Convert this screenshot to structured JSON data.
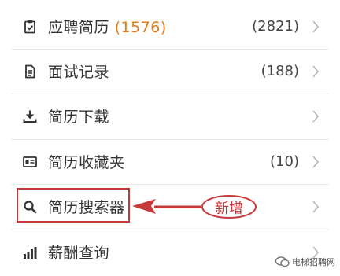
{
  "menu": {
    "items": [
      {
        "label": "应聘简历",
        "label_highlight": "(1576)",
        "count": "(2821)",
        "icon": "resume-clipboard-icon"
      },
      {
        "label": "面试记录",
        "count": "(188)",
        "icon": "document-icon"
      },
      {
        "label": "简历下载",
        "count": "",
        "icon": "download-icon"
      },
      {
        "label": "简历收藏夹",
        "count": "(10)",
        "icon": "id-card-icon"
      },
      {
        "label": "简历搜索器",
        "count": "",
        "icon": "search-icon"
      },
      {
        "label": "薪酬查询",
        "count": "",
        "icon": "bar-chart-icon"
      }
    ]
  },
  "annotation": {
    "new_tag": "新增",
    "color": "#c8393a"
  },
  "watermark": {
    "text": "电梯招聘网"
  },
  "colors": {
    "highlight_count": "#e07b1c",
    "text": "#333333",
    "divider": "#e9e9e9"
  }
}
